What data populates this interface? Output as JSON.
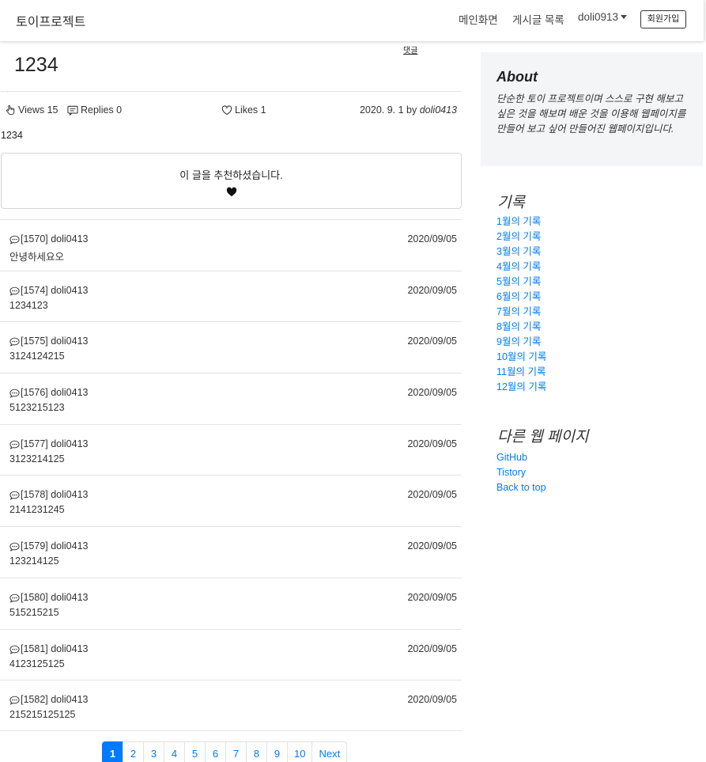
{
  "navbar": {
    "brand": "토이프로젝트",
    "main_link": "메인화면",
    "posts_link": "게시글 목록",
    "user": "doli0913",
    "signup_button": "회원가입"
  },
  "post": {
    "reply_link": "댓글",
    "title": "1234",
    "views": "Views 15",
    "replies": "Replies 0",
    "likes": "Likes 1",
    "date": "2020. 9. 1 by",
    "author": "doli0413",
    "body": "1234",
    "recommend_text": "이 글을 추천하셨습니다."
  },
  "comments": [
    {
      "head": "[1570] doli0413",
      "date": "2020/09/05",
      "body": "안녕하세요오"
    },
    {
      "head": "[1574] doli0413",
      "date": "2020/09/05",
      "body": "1234123"
    },
    {
      "head": "[1575] doli0413",
      "date": "2020/09/05",
      "body": "3124124215"
    },
    {
      "head": "[1576] doli0413",
      "date": "2020/09/05",
      "body": "5123215123"
    },
    {
      "head": "[1577] doli0413",
      "date": "2020/09/05",
      "body": "3123214125"
    },
    {
      "head": "[1578] doli0413",
      "date": "2020/09/05",
      "body": "2141231245"
    },
    {
      "head": "[1579] doli0413",
      "date": "2020/09/05",
      "body": "123214125"
    },
    {
      "head": "[1580] doli0413",
      "date": "2020/09/05",
      "body": "515215215"
    },
    {
      "head": "[1581] doli0413",
      "date": "2020/09/05",
      "body": "4123125125"
    },
    {
      "head": "[1582] doli0413",
      "date": "2020/09/05",
      "body": "215215125125"
    }
  ],
  "pagination": {
    "pages": [
      "1",
      "2",
      "3",
      "4",
      "5",
      "6",
      "7",
      "8",
      "9",
      "10"
    ],
    "active": "1",
    "next": "Next"
  },
  "sidebar": {
    "about_title": "About",
    "about_text": "단순한 토이 프로젝트이며 스스로 구현 해보고 싶은 것을 해보며 배운 것을 이용해 웹페이지를 만들어 보고 싶어 만들어진 웹페이지입니다.",
    "records_title": "기록",
    "months": [
      "1월의 기록",
      "2월의 기록",
      "3월의 기록",
      "4월의 기록",
      "5월의 기록",
      "6월의 기록",
      "7월의 기록",
      "8월의 기록",
      "9월의 기록",
      "10월의 기록",
      "11월의 기록",
      "12월의 기록"
    ],
    "other_title": "다른 웹 페이지",
    "links": [
      "GitHub",
      "Tistory",
      "Back to top"
    ]
  },
  "colors": {
    "link": "#007bff",
    "active_page": "#007bff",
    "about_bg": "#f4f5f7"
  }
}
